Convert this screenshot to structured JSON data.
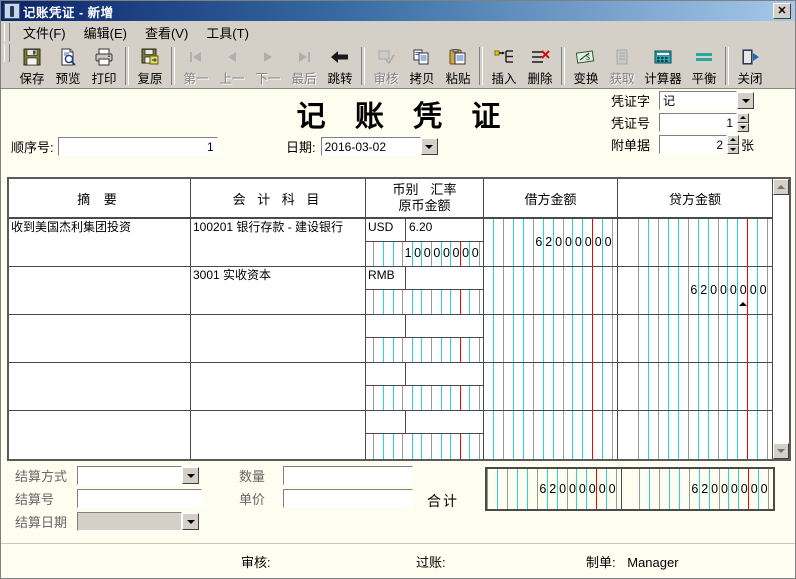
{
  "window": {
    "title": "记账凭证 - 新增",
    "close_label": "✕",
    "app_icon": "voucher-icon"
  },
  "menubar": {
    "items": [
      {
        "label": "文件(F)"
      },
      {
        "label": "编辑(E)"
      },
      {
        "label": "查看(V)"
      },
      {
        "label": "工具(T)"
      }
    ]
  },
  "toolbar": {
    "groups": [
      {
        "buttons": [
          {
            "label": "保存",
            "icon": "save-icon",
            "enabled": true
          },
          {
            "label": "预览",
            "icon": "print-preview-icon",
            "enabled": true
          },
          {
            "label": "打印",
            "icon": "print-icon",
            "enabled": true
          }
        ]
      },
      {
        "buttons": [
          {
            "label": "复原",
            "icon": "restore-icon",
            "enabled": true
          }
        ]
      },
      {
        "buttons": [
          {
            "label": "第一",
            "icon": "first-record-icon",
            "enabled": false
          },
          {
            "label": "上一",
            "icon": "previous-record-icon",
            "enabled": false
          },
          {
            "label": "下一",
            "icon": "next-record-icon",
            "enabled": false
          },
          {
            "label": "最后",
            "icon": "last-record-icon",
            "enabled": false
          },
          {
            "label": "跳转",
            "icon": "goto-icon",
            "enabled": true
          }
        ]
      },
      {
        "buttons": [
          {
            "label": "审核",
            "icon": "audit-icon",
            "enabled": false
          },
          {
            "label": "拷贝",
            "icon": "copy-icon",
            "enabled": true
          },
          {
            "label": "粘贴",
            "icon": "paste-icon",
            "enabled": true
          }
        ]
      },
      {
        "buttons": [
          {
            "label": "插入",
            "icon": "insert-row-icon",
            "enabled": true
          },
          {
            "label": "删除",
            "icon": "delete-row-icon",
            "enabled": true
          }
        ]
      },
      {
        "buttons": [
          {
            "label": "变换",
            "icon": "exchange-icon",
            "enabled": true
          },
          {
            "label": "获取",
            "icon": "fetch-icon",
            "enabled": false
          },
          {
            "label": "计算器",
            "icon": "calculator-icon",
            "enabled": true
          },
          {
            "label": "平衡",
            "icon": "balance-icon",
            "enabled": true
          }
        ]
      },
      {
        "buttons": [
          {
            "label": "关闭",
            "icon": "exit-door-icon",
            "enabled": true
          }
        ]
      }
    ]
  },
  "header": {
    "doc_title": "记 账 凭 证",
    "seq_label": "顺序号:",
    "seq_value": "1",
    "date_label": "日期:",
    "date_value": "2016-03-02",
    "voucher_word_label": "凭证字",
    "voucher_word_value": "记",
    "voucher_no_label": "凭证号",
    "voucher_no_value": "1",
    "attachment_label": "附单据",
    "attachment_value": "2",
    "attachment_unit": "张"
  },
  "grid": {
    "columns": {
      "summary": "摘 要",
      "account": "会 计 科 目",
      "currency": "币别",
      "rate": "汇率",
      "orig_amount": "原币金额",
      "debit": "借方金额",
      "credit": "贷方金额"
    },
    "rows": [
      {
        "summary": "收到美国杰利集团投资",
        "account": "100201 银行存款 - 建设银行",
        "currency": "USD",
        "rate": "6.20",
        "orig_amount": "10000000",
        "debit": "62000000",
        "credit": ""
      },
      {
        "summary": "",
        "account": "3001 实收资本",
        "currency": "RMB",
        "rate": "",
        "orig_amount": "",
        "debit": "",
        "credit": "62000000"
      },
      {
        "summary": "",
        "account": "",
        "currency": "",
        "rate": "",
        "orig_amount": "",
        "debit": "",
        "credit": ""
      },
      {
        "summary": "",
        "account": "",
        "currency": "",
        "rate": "",
        "orig_amount": "",
        "debit": "",
        "credit": ""
      },
      {
        "summary": "",
        "account": "",
        "currency": "",
        "rate": "",
        "orig_amount": "",
        "debit": "",
        "credit": ""
      }
    ]
  },
  "bottom": {
    "settle_method_label": "结算方式",
    "settle_method_value": "",
    "settle_no_label": "结算号",
    "settle_no_value": "",
    "settle_date_label": "结算日期",
    "settle_date_value": "",
    "qty_label": "数量",
    "qty_value": "",
    "price_label": "单价",
    "price_value": "",
    "total_label": "合计",
    "total_debit": "62000000",
    "total_credit": "62000000"
  },
  "footer": {
    "auditor_label": "审核:",
    "auditor_value": "",
    "posting_label": "过账:",
    "posting_value": "",
    "creator_label": "制单:",
    "creator_value": "Manager"
  },
  "colors": {
    "titlebar_start": "#0a246a",
    "titlebar_end": "#a6c8ea",
    "face": "#d4d0c8",
    "paper": "#fdfdf0",
    "grid_line": "#4a4a4a",
    "money_tick": "#2fd0d8",
    "money_decimal": "#ff0000"
  }
}
